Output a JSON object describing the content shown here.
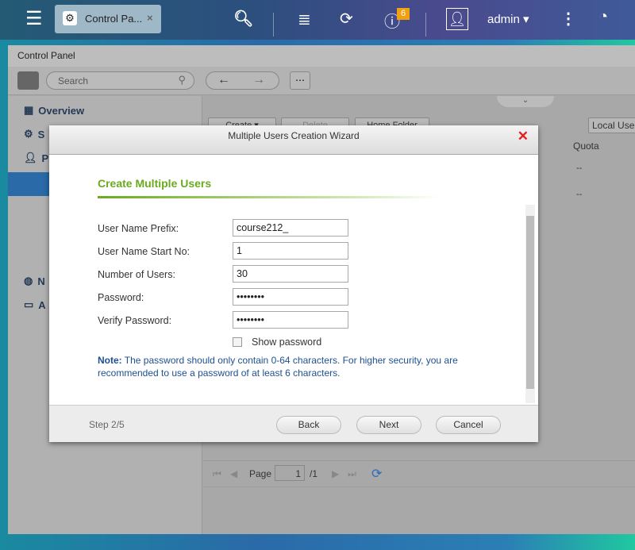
{
  "topbar": {
    "tab_title": "Control Pa...",
    "badge_count": "6",
    "user": "admin"
  },
  "window": {
    "title": "Control Panel",
    "search_placeholder": "Search"
  },
  "sidebar": {
    "items": [
      {
        "label": "Overview"
      },
      {
        "label": "S"
      },
      {
        "label": "P"
      },
      {
        "label": "N"
      },
      {
        "label": "A"
      }
    ]
  },
  "toolbar": {
    "create": "Create",
    "delete": "Delete",
    "home_folder": "Home Folder",
    "filter": "Local Use"
  },
  "table": {
    "header_quota": "Quota",
    "rows": [
      "--",
      "--"
    ]
  },
  "pager": {
    "page_label": "Page",
    "page_value": "1",
    "total": "/1"
  },
  "dialog": {
    "title": "Multiple Users Creation Wizard",
    "heading": "Create Multiple Users",
    "fields": [
      {
        "label": "User Name Prefix:",
        "value": "course212_"
      },
      {
        "label": "User Name Start No:",
        "value": "1"
      },
      {
        "label": "Number of Users:",
        "value": "30"
      },
      {
        "label": "Password:",
        "value": "••••••••"
      },
      {
        "label": "Verify Password:",
        "value": "••••••••"
      }
    ],
    "show_password": "Show password",
    "note_label": "Note:",
    "note_text": " The password should only contain 0-64 characters. For higher security, you are recommended to use a password of at least 6 characters.",
    "step": "Step 2/5",
    "back": "Back",
    "next": "Next",
    "cancel": "Cancel"
  },
  "colors": {
    "accent_green": "#6aab1e",
    "note_blue": "#1f4f8f",
    "close_red": "#e02020",
    "badge": "#f0a010"
  }
}
